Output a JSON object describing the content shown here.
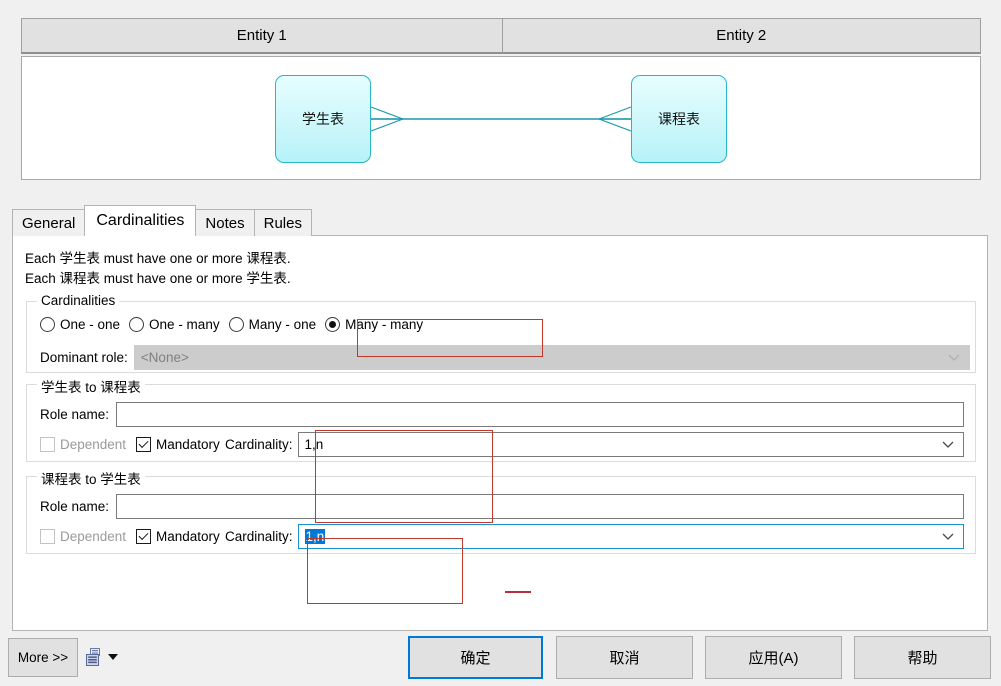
{
  "entity_headers": [
    {
      "label": "Entity 1"
    },
    {
      "label": "Entity 2"
    }
  ],
  "diagram": {
    "entity_1": "学生表",
    "entity_2": "课程表",
    "relationship_notation": "crows-foot-many-to-many",
    "box_fill": "#d2f8fb",
    "box_border": "#27b6c6"
  },
  "tabs": [
    {
      "label": "General",
      "active": false
    },
    {
      "label": "Cardinalities",
      "active": true
    },
    {
      "label": "Notes",
      "active": false
    },
    {
      "label": "Rules",
      "active": false
    }
  ],
  "sentences": {
    "line1": "Each 学生表 must have one or more 课程表.",
    "line2": "Each 课程表 must have one or more 学生表."
  },
  "cardinalities_group": {
    "title": "Cardinalities",
    "options": [
      {
        "label": "One - one",
        "selected": false
      },
      {
        "label": "One - many",
        "selected": false
      },
      {
        "label": "Many - one",
        "selected": false
      },
      {
        "label": "Many - many",
        "selected": true
      }
    ],
    "dominant_role": {
      "label": "Dominant role:",
      "value": "<None>",
      "disabled": true
    }
  },
  "role_sections": [
    {
      "title": "学生表 to 课程表",
      "role_name_label": "Role name:",
      "role_name_value": "",
      "dependent": {
        "label": "Dependent",
        "checked": false,
        "disabled": true
      },
      "mandatory": {
        "label": "Mandatory",
        "checked": true
      },
      "cardinality": {
        "label": "Cardinality:",
        "value": "1,n",
        "focused": false,
        "selected": false
      }
    },
    {
      "title": "课程表 to 学生表",
      "role_name_label": "Role name:",
      "role_name_value": "",
      "dependent": {
        "label": "Dependent",
        "checked": false,
        "disabled": true
      },
      "mandatory": {
        "label": "Mandatory",
        "checked": true
      },
      "cardinality": {
        "label": "Cardinality:",
        "value": "1,n",
        "focused": true,
        "selected": true
      }
    }
  ],
  "footer": {
    "more_label": "More >>",
    "report_icon": "report-icon",
    "report_caret_icon": "caret-down-icon",
    "ok_label": "确定",
    "cancel_label": "取消",
    "apply_label": "应用(A)",
    "help_label": "帮助",
    "focus_color": "#0078d7"
  },
  "annotations": {
    "accent_color": "#c0392b",
    "boxes": [
      "many-many-option",
      "cardinality-field-1",
      "cardinality-field-2"
    ],
    "dash": "underline-mark"
  }
}
